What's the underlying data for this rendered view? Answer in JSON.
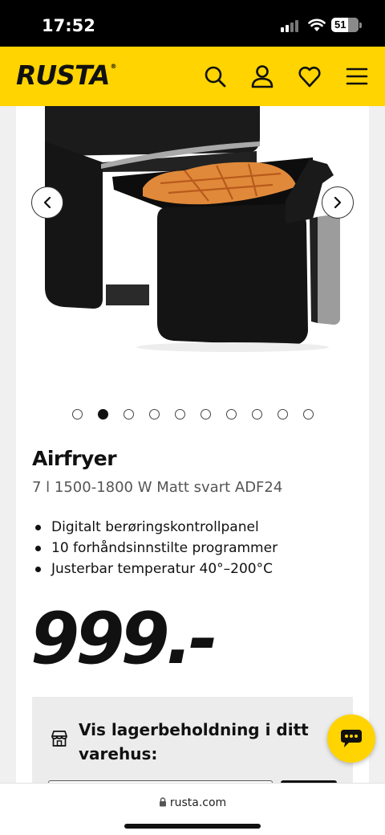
{
  "status_bar": {
    "time": "17:52",
    "battery": "51"
  },
  "header": {
    "logo": "RUSTA",
    "icons": [
      "search-icon",
      "user-icon",
      "heart-icon",
      "menu-icon"
    ],
    "background_color": "#ffd400"
  },
  "carousel": {
    "image_count": 10,
    "active_index": 1,
    "prev_icon": "chevron-left-icon",
    "next_icon": "chevron-right-icon"
  },
  "product": {
    "title": "Airfryer",
    "subtitle": "7 l 1500-1800 W Matt svart ADF24",
    "features": [
      "Digitalt berøringskontrollpanel",
      "10 forhåndsinnstilte programmer",
      "Justerbar temperatur 40°–200°C"
    ],
    "price": "999.-"
  },
  "stock": {
    "icon": "store-icon",
    "title": "Vis lagerbeholdning i ditt varehus:"
  },
  "chat": {
    "icon": "chat-icon"
  },
  "browser": {
    "url": "rusta.com"
  }
}
